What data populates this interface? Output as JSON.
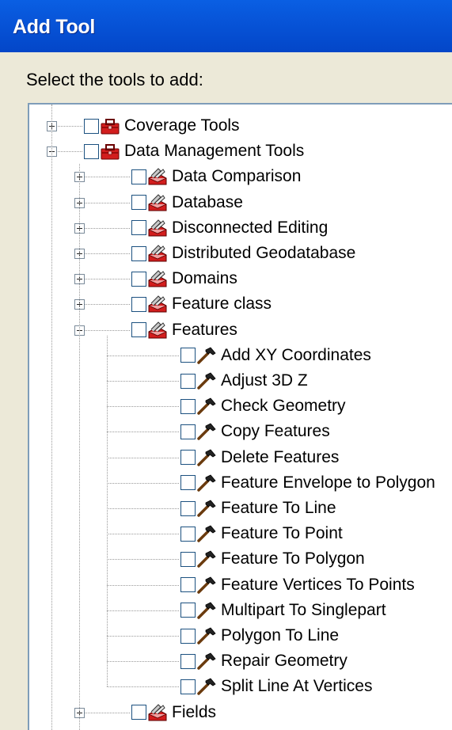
{
  "window": {
    "title": "Add Tool"
  },
  "prompt": "Select the tools to add:",
  "tree": [
    {
      "label": "Coverage Tools",
      "level": 0,
      "expander": "plus",
      "icon": "toolbox-icon"
    },
    {
      "label": "Data Management Tools",
      "level": 0,
      "expander": "minus",
      "icon": "toolbox-icon"
    },
    {
      "label": "Data Comparison",
      "level": 1,
      "expander": "plus",
      "icon": "toolset-icon"
    },
    {
      "label": "Database",
      "level": 1,
      "expander": "plus",
      "icon": "toolset-icon"
    },
    {
      "label": "Disconnected Editing",
      "level": 1,
      "expander": "plus",
      "icon": "toolset-icon"
    },
    {
      "label": "Distributed Geodatabase",
      "level": 1,
      "expander": "plus",
      "icon": "toolset-icon"
    },
    {
      "label": "Domains",
      "level": 1,
      "expander": "plus",
      "icon": "toolset-icon"
    },
    {
      "label": "Feature class",
      "level": 1,
      "expander": "plus",
      "icon": "toolset-icon"
    },
    {
      "label": "Features",
      "level": 1,
      "expander": "minus",
      "icon": "toolset-icon"
    },
    {
      "label": "Add XY Coordinates",
      "level": 2,
      "expander": "none",
      "icon": "hammer-icon"
    },
    {
      "label": "Adjust 3D Z",
      "level": 2,
      "expander": "none",
      "icon": "hammer-icon"
    },
    {
      "label": "Check Geometry",
      "level": 2,
      "expander": "none",
      "icon": "hammer-icon"
    },
    {
      "label": "Copy Features",
      "level": 2,
      "expander": "none",
      "icon": "hammer-icon"
    },
    {
      "label": "Delete Features",
      "level": 2,
      "expander": "none",
      "icon": "hammer-icon"
    },
    {
      "label": "Feature Envelope to Polygon",
      "level": 2,
      "expander": "none",
      "icon": "hammer-icon"
    },
    {
      "label": "Feature To Line",
      "level": 2,
      "expander": "none",
      "icon": "hammer-icon"
    },
    {
      "label": "Feature To Point",
      "level": 2,
      "expander": "none",
      "icon": "hammer-icon"
    },
    {
      "label": "Feature To Polygon",
      "level": 2,
      "expander": "none",
      "icon": "hammer-icon"
    },
    {
      "label": "Feature Vertices To Points",
      "level": 2,
      "expander": "none",
      "icon": "hammer-icon"
    },
    {
      "label": "Multipart To Singlepart",
      "level": 2,
      "expander": "none",
      "icon": "hammer-icon"
    },
    {
      "label": "Polygon To Line",
      "level": 2,
      "expander": "none",
      "icon": "hammer-icon"
    },
    {
      "label": "Repair Geometry",
      "level": 2,
      "expander": "none",
      "icon": "hammer-icon"
    },
    {
      "label": "Split Line At Vertices",
      "level": 2,
      "expander": "none",
      "icon": "hammer-icon"
    },
    {
      "label": "Fields",
      "level": 1,
      "expander": "plus",
      "icon": "toolset-icon"
    }
  ]
}
